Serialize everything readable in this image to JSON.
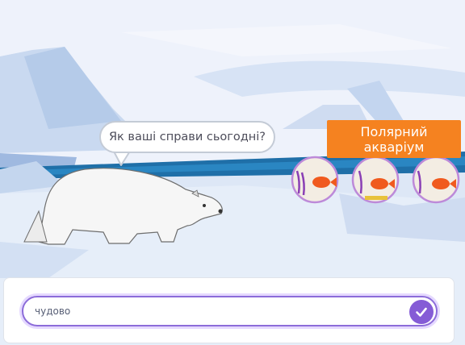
{
  "scene": {
    "speech_bubble_text": "Як ваші справи сьогодні?",
    "sign_line1": "Полярний",
    "sign_line2": "акваріум",
    "sign_color": "#f58220",
    "sky_color": "#eef2fb",
    "water_color": "#1f6fa8"
  },
  "ask_prompt": {
    "answer_value": "чудово",
    "submit_icon": "checkmark-icon",
    "accent_color": "#855cd6"
  }
}
